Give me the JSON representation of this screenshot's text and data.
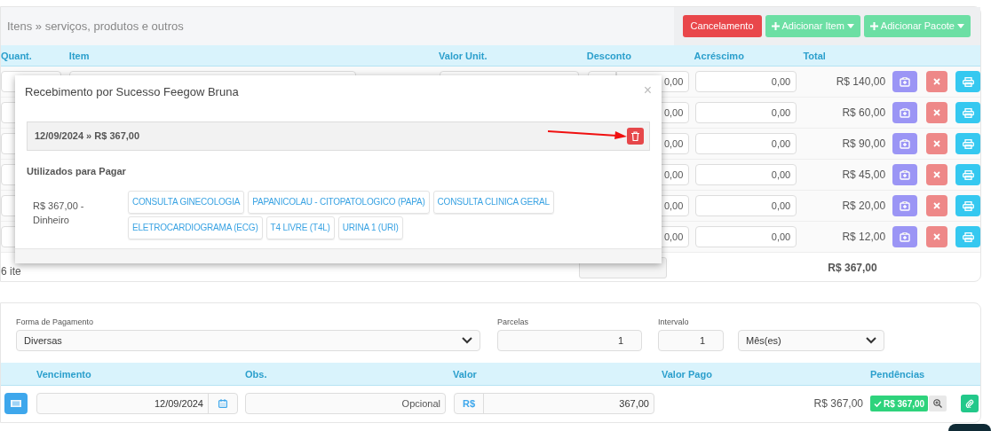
{
  "items_panel": {
    "title": "Itens » serviços, produtos e outros",
    "buttons": [
      {
        "label": "Cancelamento",
        "kind": "danger"
      },
      {
        "label": "Adicionar Item",
        "kind": "add"
      },
      {
        "label": "Adicionar Pacote",
        "kind": "add"
      }
    ],
    "columns": [
      "Quant.",
      "Item",
      "Valor Unit.",
      "Desconto",
      "Acréscimo",
      "Total"
    ],
    "rows": [
      {
        "discount": "0,00",
        "addition": "0,00",
        "total": "R$ 140,00"
      },
      {
        "discount": "0,00",
        "addition": "0,00",
        "total": "R$ 60,00"
      },
      {
        "discount": "0,00",
        "addition": "0,00",
        "total": "R$ 90,00"
      },
      {
        "discount": "0,00",
        "addition": "0,00",
        "total": "R$ 45,00"
      },
      {
        "discount": "0,00",
        "addition": "0,00",
        "total": "R$ 20,00"
      },
      {
        "discount": "0,00",
        "addition": "0,00",
        "total": "R$ 12,00"
      }
    ],
    "count": "6 ite",
    "grand_total": "R$ 367,00"
  },
  "modal": {
    "title": "Recebimento por Sucesso Feegow Bruna",
    "close": "×",
    "payment": "12/09/2024 » R$ 367,00",
    "section": "Utilizados para Pagar",
    "method": "R$ 367,00 - Dinheiro",
    "tags": [
      "CONSULTA GINECOLOGIA",
      "PAPANICOLAU - CITOPATOLOGICO (PAPA)",
      "CONSULTA CLINICA GERAL",
      "ELETROCARDIOGRAMA (ECG)",
      "T4 LIVRE (T4L)",
      "URINA 1 (URI)"
    ]
  },
  "payment": {
    "fields": [
      {
        "label": "Forma de Pagamento",
        "value": "Diversas",
        "kind": "select"
      },
      {
        "label": "Parcelas",
        "value": "1",
        "kind": "number"
      },
      {
        "label": "Intervalo",
        "value": "1",
        "kind": "number"
      },
      {
        "value": "Mês(es)",
        "kind": "select"
      }
    ],
    "columns": [
      "Vencimento",
      "Obs.",
      "Valor",
      "Valor Pago",
      "Pendências"
    ],
    "installment": {
      "due": "12/09/2024",
      "obs_placeholder": "Opcional",
      "currency": "R$",
      "value": "367,00",
      "paid": "R$ 367,00",
      "pending": "R$ 367,00"
    }
  }
}
